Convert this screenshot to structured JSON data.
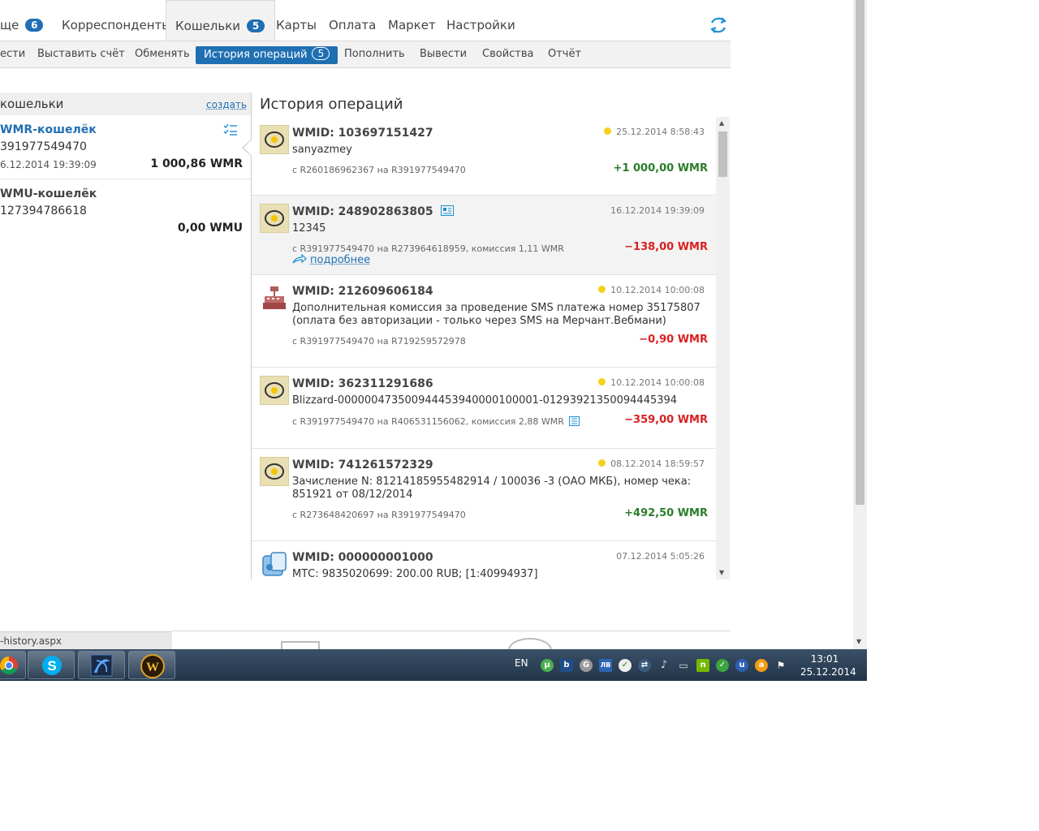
{
  "nav": {
    "tabs": [
      {
        "label": "ще",
        "badge": "6"
      },
      {
        "label": "Корреспонденты",
        "badge": ""
      },
      {
        "label": "Кошельки",
        "badge": "5"
      },
      {
        "label": "Карты",
        "badge": ""
      },
      {
        "label": "Оплата",
        "badge": ""
      },
      {
        "label": "Маркет",
        "badge": ""
      },
      {
        "label": "Настройки",
        "badge": ""
      }
    ],
    "refresh_icon": "refresh-icon"
  },
  "subnav": {
    "items": [
      {
        "label": "ести"
      },
      {
        "label": "Выставить счёт"
      },
      {
        "label": "Обменять"
      },
      {
        "label": "История операций",
        "badge": "5"
      },
      {
        "label": "Пополнить"
      },
      {
        "label": "Вывести"
      },
      {
        "label": "Свойства"
      },
      {
        "label": "Отчёт"
      }
    ]
  },
  "wallets": {
    "title": "кошельки",
    "create": "создать",
    "items": [
      {
        "name": "WMR-кошелёк",
        "number": "391977549470",
        "date": "6.12.2014 19:39:09",
        "balance": "1 000,86 WMR"
      },
      {
        "name": "WMU-кошелёк",
        "number": "127394786618",
        "date": "",
        "balance": "0,00 WMU"
      }
    ]
  },
  "history": {
    "title": "История операций",
    "ops": [
      {
        "wmid": "WMID: 103697151427",
        "ts": "25.12.2014 8:58:43",
        "dot": true,
        "desc": "sanyazmey",
        "route": "с R260186962367 на R391977549470",
        "amount": "+1 000,00 WMR",
        "sign": "pos"
      },
      {
        "wmid": "WMID: 248902863805",
        "ts": "16.12.2014 19:39:09",
        "dot": false,
        "desc": "12345",
        "route": "с R391977549470 на R273964618959, комиссия 1,11 WMR",
        "amount": "−138,00 WMR",
        "sign": "neg",
        "more": "подробнее"
      },
      {
        "wmid": "WMID: 212609606184",
        "ts": "10.12.2014 10:00:08",
        "dot": true,
        "desc": "Дополнительная комиссия за проведение SMS платежа номер 35175807 (оплата без авторизации - только через SMS на Мерчант.Вебмани)",
        "route": "с R391977549470 на R719259572978",
        "amount": "−0,90 WMR",
        "sign": "neg"
      },
      {
        "wmid": "WMID: 362311291686",
        "ts": "10.12.2014 10:00:08",
        "dot": true,
        "desc": "Blizzard-000000473500944453940000100001-0129392135009444539​4",
        "route": "с R391977549470 на R406531156062, комиссия 2,88 WMR",
        "amount": "−359,00 WMR",
        "sign": "neg"
      },
      {
        "wmid": "WMID: 741261572329",
        "ts": "08.12.2014 18:59:57",
        "dot": true,
        "desc": "Зачисление N: 81214185955482914 / 100036 -3 (ОАО МКБ), номер чека: 851921 от 08/12/2014",
        "route": "с R273648420697 на R391977549470",
        "amount": "+492,50 WMR",
        "sign": "pos"
      },
      {
        "wmid": "WMID: 000000001000",
        "ts": "07.12.2014 5:05:26",
        "dot": false,
        "desc": "МТС: 9835020699: 200.00 RUB; [1:40994937]",
        "route": "",
        "amount": "",
        "sign": "neg"
      }
    ]
  },
  "statusbar": {
    "text": "-history.aspx"
  },
  "taskbar": {
    "lang": "EN",
    "time": "13:01",
    "date": "25.12.2014",
    "apps": [
      "chrome-icon",
      "skype-icon",
      "battlenet-icon",
      "warcraft-icon"
    ]
  }
}
